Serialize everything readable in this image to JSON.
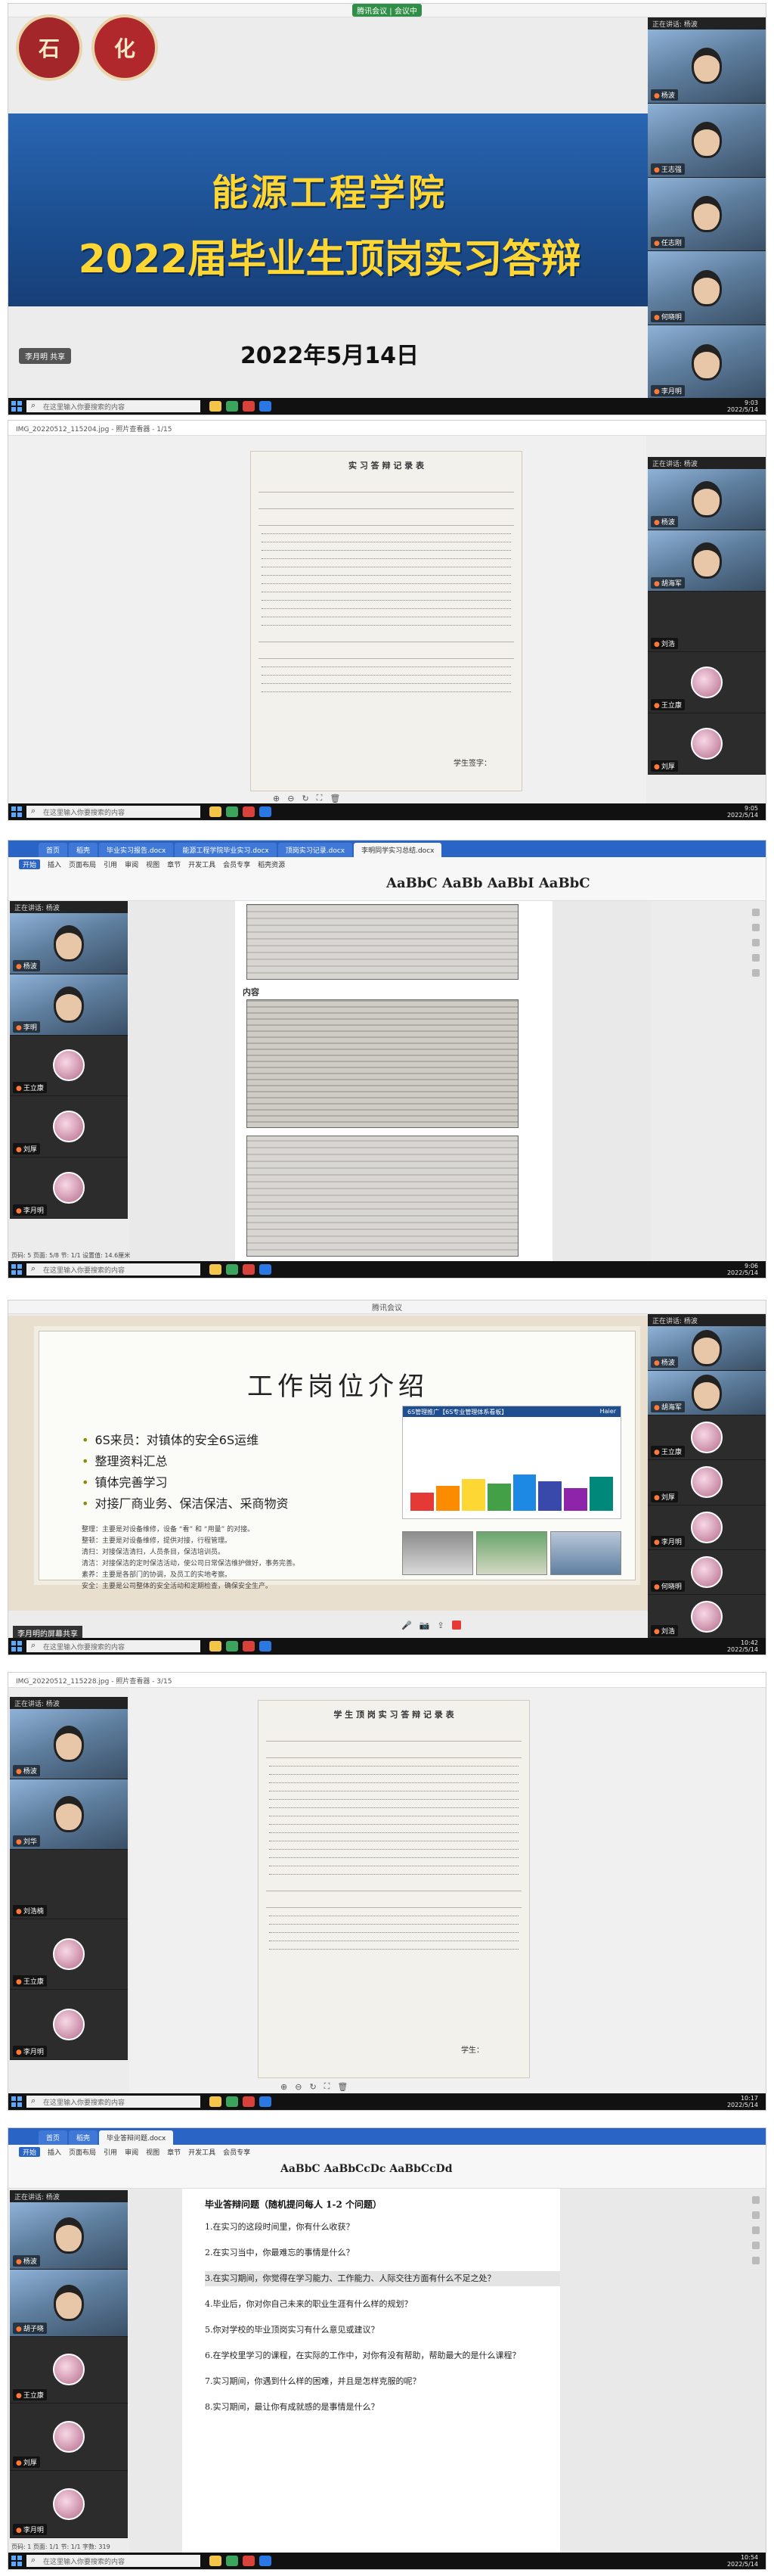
{
  "common": {
    "search_placeholder": "在这里输入你要搜索的内容",
    "recording_badge": "腾讯会议 | 会议中",
    "meeting_title": "腾讯会议",
    "presenter_label": "正在讲话: 杨波",
    "shared_by": "李月明 的屏幕共享",
    "shared_label": "李月明 共享"
  },
  "panel1": {
    "slide_line1": "能源工程学院",
    "slide_line2": "2022届毕业生顶岗实习答辩",
    "slide_date": "2022年5月14日",
    "logo_left": "石",
    "logo_right": "化",
    "shared_badge": "李月明 共享",
    "time": "9:03",
    "date": "2022/5/14",
    "participants": [
      {
        "name": "杨波",
        "kind": "video"
      },
      {
        "name": "王志强",
        "kind": "video"
      },
      {
        "name": "任志刚",
        "kind": "video"
      },
      {
        "name": "何晓明",
        "kind": "video"
      },
      {
        "name": "李月明",
        "kind": "video"
      }
    ]
  },
  "panel2": {
    "viewer_file": "IMG_20220512_115204.jpg - 照片查看器 - 1/15",
    "doc_heading": "实 习 答 辩 记 录 表",
    "signature": "学生签字：",
    "time": "9:05",
    "date": "2022/5/14",
    "participants": [
      {
        "name": "杨波",
        "kind": "video"
      },
      {
        "name": "胡海军",
        "kind": "video"
      },
      {
        "name": "刘浩",
        "kind": "dark"
      },
      {
        "name": "王立康",
        "kind": "avatar"
      },
      {
        "name": "刘厚",
        "kind": "avatar"
      }
    ]
  },
  "panel3": {
    "tabs": [
      "首页",
      "稻壳",
      "毕业实习报告.docx",
      "能源工程学院毕业实习.docx",
      "顶岗实习记录.docx",
      "李明同学实习总结.docx"
    ],
    "menu": [
      "开始",
      "插入",
      "页面布局",
      "引用",
      "审阅",
      "视图",
      "章节",
      "开发工具",
      "会员专享",
      "稻壳资源"
    ],
    "active_menu": "开始",
    "style_sample": "AaBbC AaBb AaBbI AaBbC",
    "content_label": "内容",
    "status_left": "页码: 5  页面: 5/8  节: 1/1  设置值: 14.6厘米",
    "time": "9:06",
    "date": "2022/5/14",
    "participants": [
      {
        "name": "杨波",
        "kind": "video"
      },
      {
        "name": "李明",
        "kind": "video"
      },
      {
        "name": "王立康",
        "kind": "avatar"
      },
      {
        "name": "刘厚",
        "kind": "avatar"
      },
      {
        "name": "李月明",
        "kind": "avatar"
      }
    ]
  },
  "panel4": {
    "job_title": "工作岗位介绍",
    "bullets": [
      "6S来员：对镇体的安全6S运维",
      "整理资料汇总",
      "镇体完善学习",
      "对接厂商业务、保洁保洁、采商物资"
    ],
    "notes": [
      "整理：主要是对设备维修，设备 “看” 和 “用量” 的对接。",
      "整顿：主要是对设备维修，提供对接，行程管理。",
      "清扫：对接保洁清扫，人员条目，保洁培训员。",
      "清洁：对接保洁的定时保洁活动，使公司日常保洁维护做好，事务完善。",
      "素养：主要是各部门的协调，及员工的实地考察。",
      "安全：主要是公司整体的安全活动和定期检查，确保安全生产。"
    ],
    "chart_head_left": "6S管理推广【6S专业管理体系看板】",
    "chart_head_right": "Haier",
    "shared_footer": "李月明的屏幕共享",
    "time": "10:42",
    "date": "2022/5/14",
    "participants": [
      {
        "name": "杨波",
        "kind": "video"
      },
      {
        "name": "胡海军",
        "kind": "video"
      },
      {
        "name": "王立康",
        "kind": "avatar"
      },
      {
        "name": "刘厚",
        "kind": "avatar"
      },
      {
        "name": "李月明",
        "kind": "avatar"
      },
      {
        "name": "何晓明",
        "kind": "avatar"
      },
      {
        "name": "刘浩",
        "kind": "avatar"
      }
    ]
  },
  "panel5": {
    "viewer_file": "IMG_20220512_115228.jpg - 照片查看器 - 3/15",
    "doc_heading": "学 生 顶 岗 实 习 答 辩 记 录 表",
    "signature": "学生：",
    "time": "10:17",
    "date": "2022/5/14",
    "participants": [
      {
        "name": "杨波",
        "kind": "video"
      },
      {
        "name": "刘华",
        "kind": "video"
      },
      {
        "name": "刘浩楠",
        "kind": "dark"
      },
      {
        "name": "王立康",
        "kind": "avatar"
      },
      {
        "name": "李月明",
        "kind": "avatar"
      }
    ]
  },
  "panel6": {
    "tabs": [
      "首页",
      "稻壳",
      "毕业答辩问题.docx"
    ],
    "menu": [
      "开始",
      "插入",
      "页面布局",
      "引用",
      "审阅",
      "视图",
      "章节",
      "开发工具",
      "会员专享"
    ],
    "active_menu": "开始",
    "style_sample": "AaBbC AaBbCcDc AaBbCcDd",
    "q_title": "毕业答辩问题（随机提问每人 1-2 个问题）",
    "questions": [
      "1.在实习的这段时间里，你有什么收获？",
      "2.在实习当中，你最难忘的事情是什么？",
      "3.在实习期间，你觉得在学习能力、工作能力、人际交往方面有什么不足之处？",
      "4.毕业后，你对你自己未来的职业生涯有什么样的规划？",
      "5.你对学校的毕业顶岗实习有什么意见或建议？",
      "6.在学校里学习的课程，在实际的工作中，对你有没有帮助，帮助最大的是什么课程？",
      "7.实习期间，你遇到什么样的困难，并且是怎样克服的呢？",
      "8.实习期间，最让你有成就感的是事情是什么？"
    ],
    "status_left": "页码: 1  页面: 1/1  节: 1/1  字数: 319",
    "time": "10:54",
    "date": "2022/5/14",
    "participants": [
      {
        "name": "杨波",
        "kind": "video"
      },
      {
        "name": "胡子晓",
        "kind": "video"
      },
      {
        "name": "王立康",
        "kind": "avatar"
      },
      {
        "name": "刘厚",
        "kind": "avatar"
      },
      {
        "name": "李月明",
        "kind": "avatar"
      }
    ]
  }
}
